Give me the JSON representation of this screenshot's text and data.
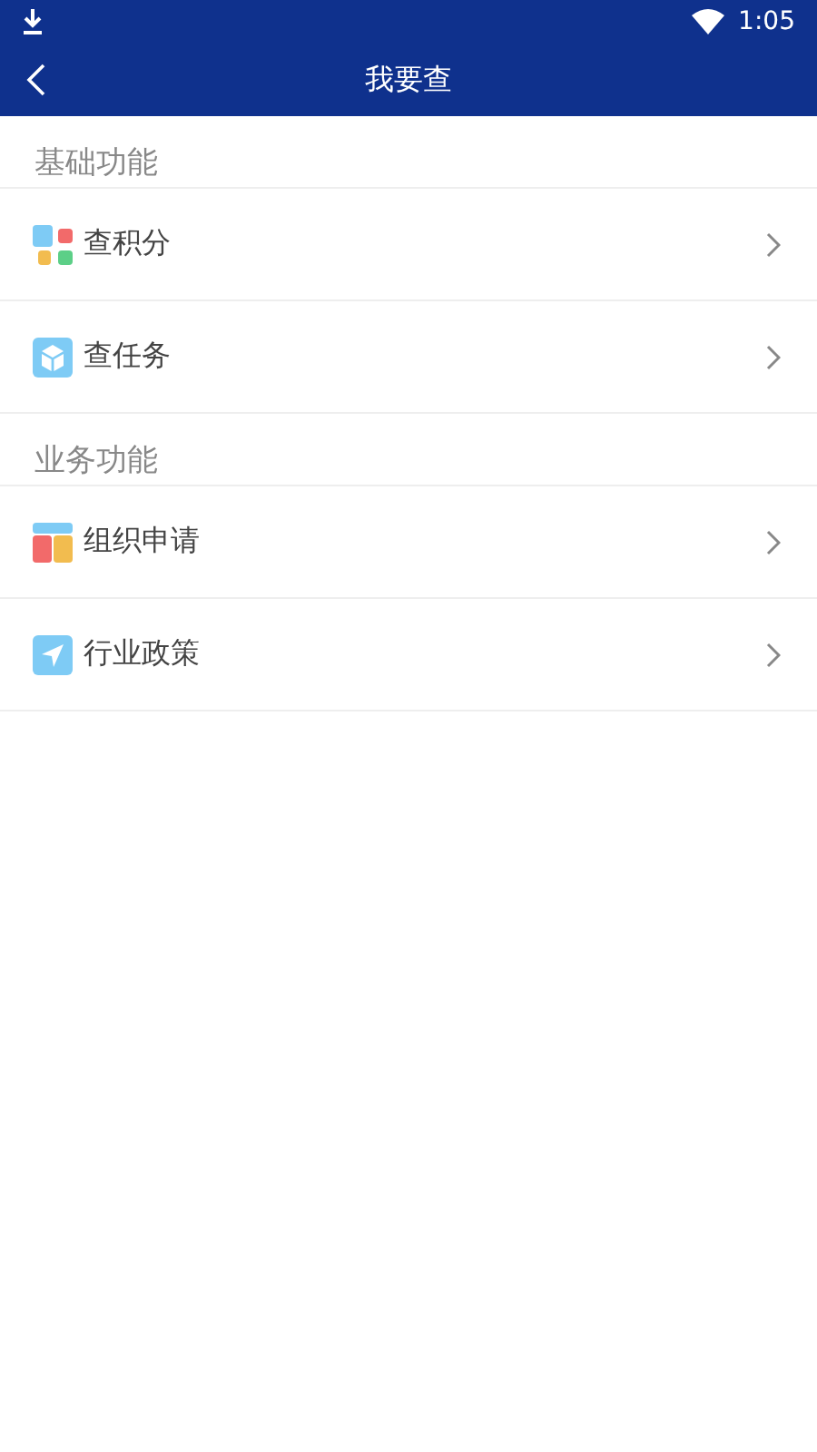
{
  "status_bar": {
    "time": "1:05"
  },
  "header": {
    "title": "我要查"
  },
  "sections": [
    {
      "title": "基础功能",
      "items": [
        {
          "label": "查积分",
          "kind": "blocks"
        },
        {
          "label": "查任务",
          "kind": "cube"
        }
      ]
    },
    {
      "title": "业务功能",
      "items": [
        {
          "label": "组织申请",
          "kind": "panels"
        },
        {
          "label": "行业政策",
          "kind": "arrow"
        }
      ]
    }
  ]
}
